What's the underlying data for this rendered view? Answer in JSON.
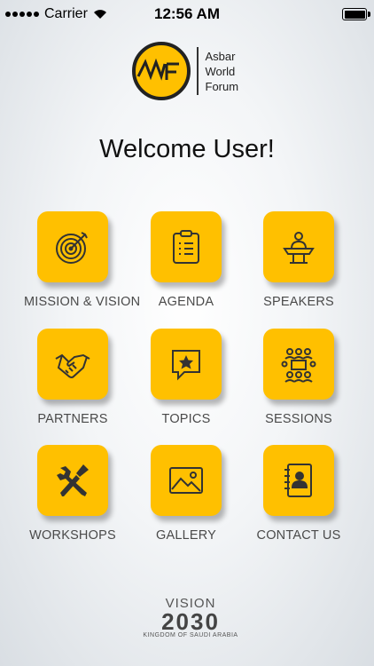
{
  "status_bar": {
    "carrier": "Carrier",
    "time": "12:56 AM"
  },
  "logo": {
    "mark": "AWF",
    "line1": "Asbar",
    "line2": "World",
    "line3": "Forum"
  },
  "welcome": "Welcome User!",
  "tiles": [
    {
      "label": "MISSION & VISION",
      "icon": "target-icon"
    },
    {
      "label": "AGENDA",
      "icon": "clipboard-list-icon"
    },
    {
      "label": "SPEAKERS",
      "icon": "podium-speaker-icon"
    },
    {
      "label": "PARTNERS",
      "icon": "handshake-icon"
    },
    {
      "label": "TOPICS",
      "icon": "star-speech-bubble-icon"
    },
    {
      "label": "SESSIONS",
      "icon": "meeting-table-icon"
    },
    {
      "label": "WORKSHOPS",
      "icon": "tools-icon"
    },
    {
      "label": "GALLERY",
      "icon": "image-icon"
    },
    {
      "label": "CONTACT US",
      "icon": "contact-book-icon"
    }
  ],
  "footer": {
    "vision": "VISION",
    "year": "2030",
    "kingdom": "KINGDOM OF SAUDI ARABIA"
  },
  "colors": {
    "tile": "#ffc000",
    "icon": "#333333"
  }
}
